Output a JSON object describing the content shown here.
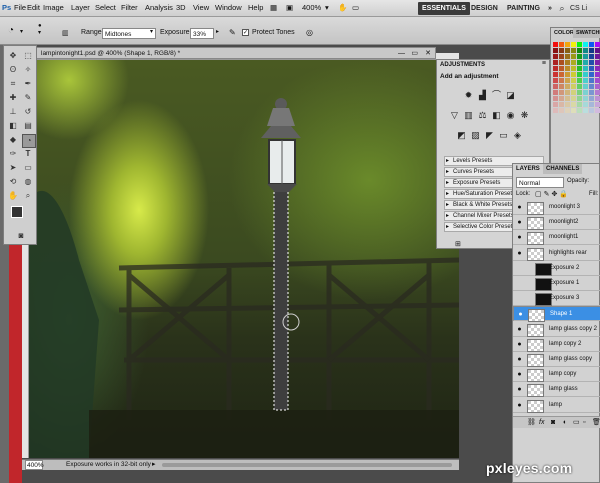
{
  "menu": [
    "File",
    "Edit",
    "Image",
    "Layer",
    "Select",
    "Filter",
    "Analysis",
    "3D",
    "View",
    "Window",
    "Help"
  ],
  "zoom_label": "400%",
  "workspace": {
    "essentials": "ESSENTIALS",
    "design": "DESIGN",
    "painting": "PAINTING",
    "more": "»",
    "cslive": "CS Li"
  },
  "options": {
    "range_label": "Range:",
    "range_value": "Midtones",
    "exposure_label": "Exposure:",
    "exposure_value": "33%",
    "protect_tones": "Protect Tones"
  },
  "document": {
    "tab_title": "lampintonight1.psd @ 400% (Shape 1, RGB/8) *",
    "status_zoom": "400%",
    "status_text": "Exposure works in 32-bit only"
  },
  "adjustments": {
    "tab": "ADJUSTMENTS",
    "title": "Add an adjustment",
    "presets": [
      "Levels Presets",
      "Curves Presets",
      "Exposure Presets",
      "Hue/Saturation Presets",
      "Black & White Presets",
      "Channel Mixer Presets",
      "Selective Color Presets"
    ]
  },
  "color_panel": {
    "tab": "COLOR",
    "tab2": "SWATCHES"
  },
  "layers_panel": {
    "tab": "LAYERS",
    "tab2": "CHANNELS",
    "blend": "Normal",
    "opacity": "Opacity:",
    "lock": "Lock:",
    "fill": "Fill:",
    "layers": [
      {
        "name": "moonlight 3",
        "visible": true,
        "selected": false
      },
      {
        "name": "moonlight2",
        "visible": true,
        "selected": false
      },
      {
        "name": "moonlight1",
        "visible": true,
        "selected": false
      },
      {
        "name": "highlights rear",
        "visible": true,
        "selected": false
      },
      {
        "name": "Exposure 2",
        "visible": false,
        "selected": false
      },
      {
        "name": "Exposure 1",
        "visible": false,
        "selected": false
      },
      {
        "name": "Exposure 3",
        "visible": false,
        "selected": false
      },
      {
        "name": "Shape 1",
        "visible": true,
        "selected": true
      },
      {
        "name": "lamp glass copy 2",
        "visible": true,
        "selected": false
      },
      {
        "name": "lamp copy 2",
        "visible": true,
        "selected": false
      },
      {
        "name": "lamp glass copy",
        "visible": true,
        "selected": false
      },
      {
        "name": "lamp copy",
        "visible": true,
        "selected": false
      },
      {
        "name": "lamp glass",
        "visible": true,
        "selected": false
      },
      {
        "name": "lamp",
        "visible": true,
        "selected": false
      }
    ],
    "footer_icons": [
      "link-icon",
      "fx-icon",
      "mask-icon",
      "adjustment-icon",
      "folder-icon",
      "new-layer-icon",
      "trash-icon"
    ]
  },
  "watermark": "pxleyes.com"
}
